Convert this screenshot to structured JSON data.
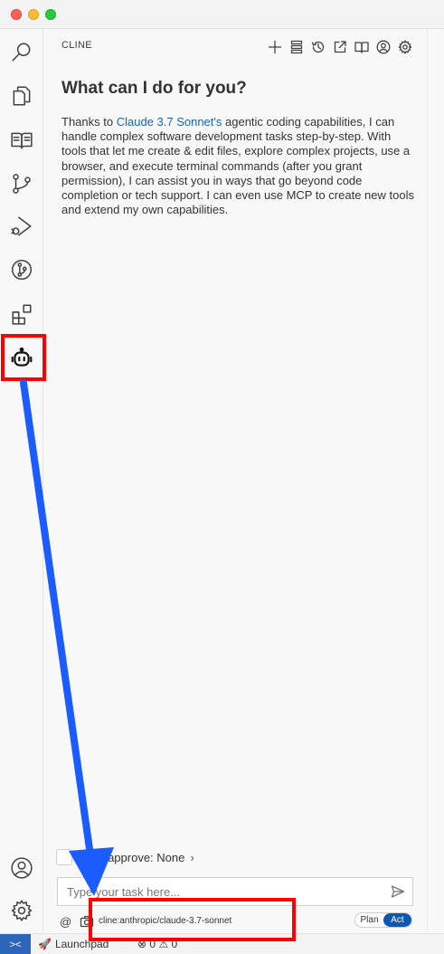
{
  "panel": {
    "title": "CLINE",
    "headline": "What can I do for you?",
    "intro_before": "Thanks to ",
    "intro_link": "Claude 3.7 Sonnet's",
    "intro_after": " agentic coding capabilities, I can handle complex software development tasks step-by-step. With tools that let me create & edit files, explore complex projects, use a browser, and execute terminal commands (after you grant permission), I can assist you in ways that go beyond code completion or tech support. I can even use MCP to create new tools and extend my own capabilities."
  },
  "auto_approve": {
    "prefix": "Auto-",
    "label": "approve: None",
    "chevron": "›"
  },
  "input": {
    "placeholder": "Type your task here..."
  },
  "bottom": {
    "at": "@",
    "model": "cline:anthropic/claude-3.7-sonnet",
    "plan": "Plan",
    "act": "Act",
    "active_mode": "Act"
  },
  "status": {
    "launchpad": "Launchpad",
    "errors": "0",
    "warnings": "0",
    "remote_icon": "remote-icon"
  },
  "icons": {
    "activity": [
      "search-icon",
      "explorer-icon",
      "book-icon",
      "source-control-icon",
      "run-debug-icon",
      "git-graph-icon",
      "extensions-icon",
      "cline-robot-icon",
      "account-icon",
      "settings-gear-icon"
    ],
    "toolbar": [
      "plus-icon",
      "mcp-server-icon",
      "history-icon",
      "popout-icon",
      "docs-book-icon",
      "account-icon",
      "gear-icon"
    ]
  },
  "colors": {
    "link": "#1a64b5",
    "act_toggle": "#0e58b4",
    "highlight": "#ff0000",
    "arrow": "#1a5cff",
    "status_remote": "#2d66b8"
  }
}
